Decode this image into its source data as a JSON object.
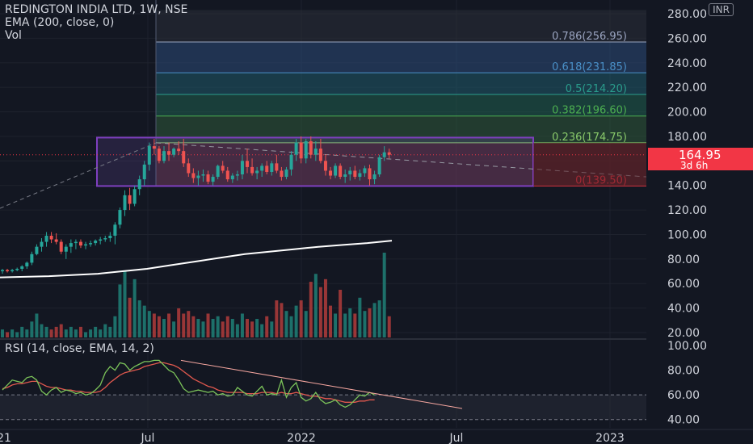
{
  "legend": {
    "symbol": "REDINGTON INDIA LTD, 1W, NSE",
    "ema": "EMA (200, close, 0)",
    "vol": "Vol"
  },
  "rsi_legend": "RSI (14, close, EMA, 14, 2)",
  "currency": "INR",
  "last_price": "164.95",
  "countdown": "3d 6h",
  "colors": {
    "up": "#26a69a",
    "down": "#ef5350",
    "bg": "#131722",
    "box": "#7e3fbf",
    "ema": "#ffffff",
    "rsi": "#7cc45a",
    "rsi_ma": "#e0584e"
  },
  "chart_data": {
    "type": "line",
    "title": "REDINGTON INDIA LTD, 1W, NSE",
    "x_ticks": [
      "21",
      "Jul",
      "2022",
      "Jul",
      "2023"
    ],
    "y_ticks": [
      "20.00",
      "40.00",
      "60.00",
      "80.00",
      "100.00",
      "120.00",
      "140.00",
      "160.00",
      "180.00",
      "200.00",
      "220.00",
      "240.00",
      "260.00",
      "280.00"
    ],
    "ylim": [
      20,
      283
    ],
    "fibonacci": [
      {
        "label": "0.786(256.95)",
        "value": 256.95
      },
      {
        "label": "0.618(231.85)",
        "value": 231.85
      },
      {
        "label": "0.5(214.20)",
        "value": 214.2
      },
      {
        "label": "0.382(196.60)",
        "value": 196.6
      },
      {
        "label": "0.236(174.75)",
        "value": 174.75
      },
      {
        "label": "0(139.50)",
        "value": 139.5
      }
    ],
    "consolidation_range": [
      139.5,
      179
    ],
    "ema200": {
      "name": "EMA (200, close, 0)",
      "values": [
        65,
        65.5,
        66,
        67,
        68,
        70,
        72,
        75,
        78,
        81,
        84,
        86,
        88,
        90,
        91.5,
        93,
        95
      ]
    },
    "candles": [
      [
        70,
        72,
        68,
        71
      ],
      [
        71,
        72,
        69,
        70
      ],
      [
        70,
        72,
        69,
        71
      ],
      [
        71,
        73,
        70,
        72
      ],
      [
        72,
        75,
        70,
        74
      ],
      [
        74,
        78,
        72,
        77
      ],
      [
        77,
        86,
        75,
        84
      ],
      [
        84,
        92,
        83,
        90
      ],
      [
        90,
        97,
        86,
        94
      ],
      [
        94,
        102,
        90,
        99
      ],
      [
        99,
        102,
        93,
        96
      ],
      [
        96,
        101,
        92,
        94
      ],
      [
        94,
        96,
        84,
        86
      ],
      [
        86,
        92,
        80,
        90
      ],
      [
        90,
        96,
        85,
        93
      ],
      [
        93,
        96,
        88,
        94
      ],
      [
        94,
        96,
        89,
        91
      ],
      [
        91,
        94,
        88,
        92
      ],
      [
        92,
        95,
        90,
        93
      ],
      [
        93,
        96,
        91,
        95
      ],
      [
        95,
        98,
        92,
        96
      ],
      [
        96,
        99,
        94,
        97
      ],
      [
        97,
        102,
        94,
        99
      ],
      [
        99,
        110,
        92,
        108
      ],
      [
        108,
        122,
        105,
        120
      ],
      [
        120,
        136,
        115,
        132
      ],
      [
        132,
        138,
        120,
        125
      ],
      [
        125,
        140,
        123,
        137
      ],
      [
        137,
        148,
        132,
        145
      ],
      [
        145,
        160,
        140,
        157
      ],
      [
        157,
        175,
        152,
        172
      ],
      [
        172,
        178,
        165,
        170
      ],
      [
        170,
        172,
        158,
        160
      ],
      [
        160,
        172,
        158,
        168
      ],
      [
        168,
        175,
        160,
        165
      ],
      [
        165,
        171,
        163,
        170
      ],
      [
        170,
        176,
        165,
        168
      ],
      [
        168,
        178,
        155,
        158
      ],
      [
        158,
        162,
        147,
        150
      ],
      [
        150,
        154,
        142,
        146
      ],
      [
        146,
        152,
        140,
        148
      ],
      [
        148,
        153,
        143,
        149
      ],
      [
        149,
        152,
        141,
        143
      ],
      [
        143,
        149,
        140,
        147
      ],
      [
        147,
        157,
        145,
        156
      ],
      [
        156,
        160,
        150,
        152
      ],
      [
        152,
        155,
        143,
        145
      ],
      [
        145,
        150,
        142,
        148
      ],
      [
        148,
        152,
        144,
        149
      ],
      [
        149,
        165,
        145,
        160
      ],
      [
        160,
        170,
        150,
        155
      ],
      [
        155,
        162,
        148,
        150
      ],
      [
        150,
        155,
        145,
        152
      ],
      [
        152,
        158,
        147,
        156
      ],
      [
        156,
        160,
        149,
        151
      ],
      [
        151,
        160,
        148,
        158
      ],
      [
        158,
        165,
        150,
        152
      ],
      [
        152,
        155,
        144,
        147
      ],
      [
        147,
        155,
        145,
        153
      ],
      [
        153,
        168,
        148,
        165
      ],
      [
        165,
        178,
        160,
        175
      ],
      [
        175,
        180,
        158,
        162
      ],
      [
        162,
        178,
        158,
        176
      ],
      [
        176,
        180,
        162,
        165
      ],
      [
        165,
        176,
        160,
        170
      ],
      [
        170,
        178,
        158,
        160
      ],
      [
        160,
        165,
        148,
        152
      ],
      [
        152,
        155,
        145,
        148
      ],
      [
        148,
        158,
        146,
        156
      ],
      [
        156,
        158,
        145,
        147
      ],
      [
        147,
        153,
        142,
        149
      ],
      [
        149,
        155,
        144,
        152
      ],
      [
        152,
        156,
        145,
        147
      ],
      [
        147,
        153,
        144,
        150
      ],
      [
        150,
        156,
        147,
        154
      ],
      [
        154,
        157,
        140,
        145
      ],
      [
        145,
        152,
        141,
        149
      ],
      [
        149,
        165,
        147,
        163
      ],
      [
        163,
        172,
        160,
        167
      ],
      [
        167,
        170,
        162,
        165
      ]
    ],
    "volume": [
      3,
      2,
      3,
      2,
      4,
      3,
      6,
      9,
      5,
      4,
      3,
      4,
      5,
      3,
      4,
      3,
      4,
      2,
      3,
      4,
      3,
      5,
      4,
      8,
      20,
      25,
      15,
      22,
      14,
      12,
      10,
      9,
      8,
      7,
      9,
      6,
      11,
      9,
      10,
      8,
      7,
      6,
      9,
      7,
      8,
      6,
      8,
      7,
      5,
      9,
      7,
      6,
      7,
      5,
      8,
      6,
      14,
      13,
      10,
      8,
      12,
      14,
      10,
      21,
      24,
      19,
      22,
      12,
      9,
      18,
      9,
      11,
      9,
      15,
      10,
      11,
      13,
      14,
      32,
      8
    ],
    "rsi": {
      "name": "RSI (14, close, EMA, 14, 2)",
      "ticks": [
        "40.00",
        "60.00",
        "80.00",
        "100.00"
      ],
      "values": [
        64,
        68,
        72,
        71,
        70,
        74,
        75,
        72,
        63,
        60,
        64,
        66,
        62,
        64,
        63,
        61,
        62,
        60,
        61,
        64,
        68,
        78,
        83,
        80,
        86,
        85,
        80,
        83,
        85,
        87,
        87,
        88,
        88,
        84,
        80,
        78,
        72,
        65,
        62,
        63,
        64,
        63,
        62,
        63,
        60,
        61,
        59,
        60,
        66,
        63,
        60,
        59,
        63,
        67,
        60,
        61,
        60,
        72,
        58,
        66,
        70,
        58,
        55,
        57,
        62,
        56,
        53,
        54,
        56,
        52,
        50,
        52,
        56,
        60,
        59,
        62,
        60
      ],
      "ma_values": [
        65,
        66,
        68,
        69,
        69,
        70,
        71,
        71,
        69,
        67,
        66,
        66,
        65,
        64,
        64,
        63,
        63,
        62,
        62,
        62,
        63,
        66,
        70,
        73,
        76,
        78,
        79,
        80,
        81,
        83,
        84,
        85,
        86,
        86,
        85,
        84,
        82,
        79,
        76,
        73,
        71,
        69,
        67,
        66,
        64,
        63,
        62,
        62,
        62,
        62,
        61,
        61,
        61,
        62,
        62,
        62,
        61,
        62,
        61,
        61,
        62,
        61,
        60,
        59,
        59,
        58,
        57,
        57,
        56,
        55,
        54,
        54,
        54,
        55,
        55,
        56,
        56
      ]
    }
  }
}
